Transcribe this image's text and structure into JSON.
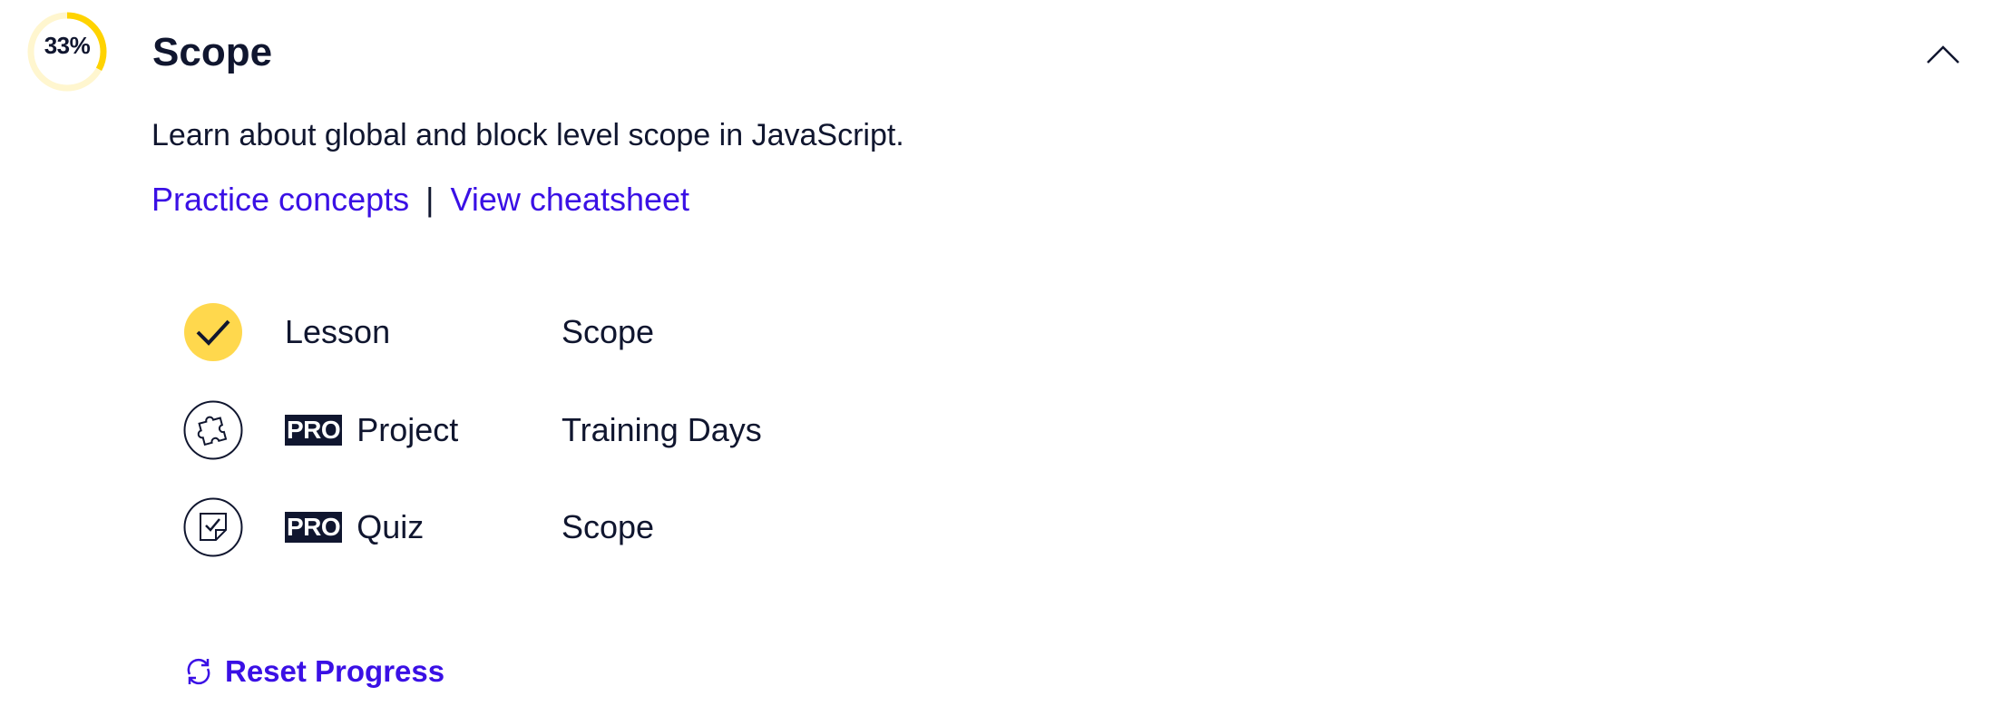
{
  "module": {
    "progress_label": "33%",
    "progress_fraction": 0.33,
    "title": "Scope",
    "description": "Learn about global and block level scope in JavaScript.",
    "collapse_icon": "chevron-up-icon"
  },
  "links": {
    "practice": "Practice concepts",
    "separator": "|",
    "cheatsheet": "View cheatsheet"
  },
  "items": [
    {
      "type": "Lesson",
      "name": "Scope",
      "pro": false,
      "status": "completed",
      "icon": "check-circle-icon"
    },
    {
      "type": "Project",
      "name": "Training Days",
      "pro": true,
      "pro_label": "PRO",
      "status": "incomplete",
      "icon": "puzzle-icon"
    },
    {
      "type": "Quiz",
      "name": "Scope",
      "pro": true,
      "pro_label": "PRO",
      "status": "incomplete",
      "icon": "quiz-icon"
    }
  ],
  "reset": {
    "label": "Reset Progress",
    "icon": "refresh-icon"
  },
  "colors": {
    "progress_fill": "#ffd300",
    "progress_track": "#fff6cf",
    "link": "#3a10e5",
    "text": "#10162f",
    "completed_fill": "#ffd84d"
  }
}
